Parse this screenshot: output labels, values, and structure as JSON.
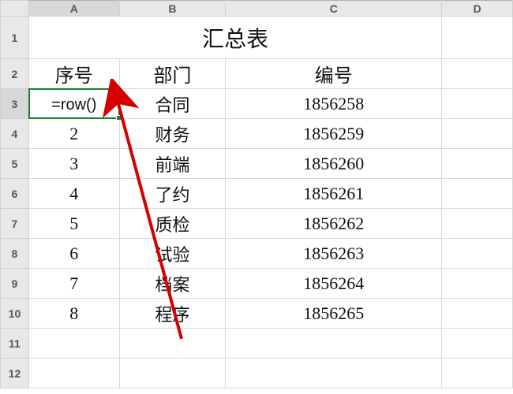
{
  "columns": {
    "A": "A",
    "B": "B",
    "C": "C",
    "D": "D"
  },
  "title": "汇总表",
  "headers": {
    "seq": "序号",
    "dept": "部门",
    "code": "编号"
  },
  "active_cell_formula": "=row()",
  "rows": [
    {
      "r": "1"
    },
    {
      "r": "2"
    },
    {
      "r": "3",
      "seq": "=row()",
      "dept": "合同",
      "code": "1856258"
    },
    {
      "r": "4",
      "seq": "2",
      "dept": "财务",
      "code": "1856259"
    },
    {
      "r": "5",
      "seq": "3",
      "dept": "前端",
      "code": "1856260"
    },
    {
      "r": "6",
      "seq": "4",
      "dept": "了约",
      "code": "1856261"
    },
    {
      "r": "7",
      "seq": "5",
      "dept": "质检",
      "code": "1856262"
    },
    {
      "r": "8",
      "seq": "6",
      "dept": "试验",
      "code": "1856263"
    },
    {
      "r": "9",
      "seq": "7",
      "dept": "档案",
      "code": "1856264"
    },
    {
      "r": "10",
      "seq": "8",
      "dept": "程序",
      "code": "1856265"
    },
    {
      "r": "11"
    },
    {
      "r": "12"
    }
  ]
}
